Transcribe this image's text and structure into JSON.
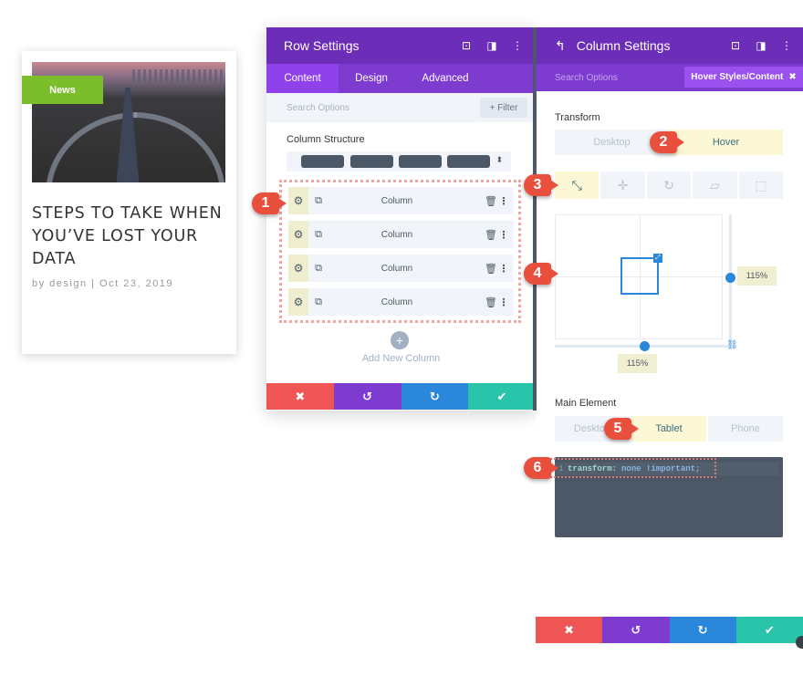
{
  "blog_card": {
    "tag": "News",
    "title": "STEPS TO TAKE WHEN YOU’VE LOST YOUR DATA",
    "meta": "by design | Oct 23, 2019",
    "tag_color": "#7cbd2c"
  },
  "row_settings": {
    "title": "Row Settings",
    "header_icons": [
      "focus-icon",
      "sidebar-toggle-icon",
      "more-vertical-icon"
    ],
    "tabs": [
      {
        "label": "Content",
        "active": true
      },
      {
        "label": "Design",
        "active": false
      },
      {
        "label": "Advanced",
        "active": false
      }
    ],
    "search_placeholder": "Search Options",
    "filter_label": "+ Filter",
    "column_structure_label": "Column Structure",
    "column_structure_blocks": 4,
    "columns": [
      {
        "label": "Column"
      },
      {
        "label": "Column"
      },
      {
        "label": "Column"
      },
      {
        "label": "Column"
      }
    ],
    "add_column_label": "Add New Column",
    "add_column_icon": "+"
  },
  "column_settings": {
    "title": "Column Settings",
    "back_icon": "↰",
    "search_placeholder": "Search Options",
    "hover_pill_label": "Hover Styles/Content",
    "hover_pill_close": "✖",
    "transform": {
      "label": "Transform",
      "modes": [
        {
          "label": "Desktop",
          "active": false
        },
        {
          "label": "Hover",
          "active": true
        }
      ],
      "tools": [
        {
          "name": "scale",
          "glyph": "⤡",
          "active": true
        },
        {
          "name": "translate",
          "glyph": "✛",
          "active": false
        },
        {
          "name": "rotate",
          "glyph": "↻",
          "active": false
        },
        {
          "name": "skew",
          "glyph": "▱",
          "active": false
        },
        {
          "name": "origin",
          "glyph": "⬚",
          "active": false
        }
      ],
      "scale_y": "115%",
      "scale_x": "115%"
    },
    "main_element": {
      "label": "Main Element",
      "devices": [
        {
          "label": "Desktop",
          "active": false
        },
        {
          "label": "Tablet",
          "active": true
        },
        {
          "label": "Phone",
          "active": false
        }
      ],
      "code_line_number": "1",
      "code_property": "transform:",
      "code_value": "none !important;"
    }
  },
  "action_bar": {
    "cancel": "✖",
    "undo": "↺",
    "redo": "↻",
    "save": "✔"
  },
  "callouts": [
    "1",
    "2",
    "3",
    "4",
    "5",
    "6"
  ],
  "colors": {
    "purple_header": "#6c2eb9",
    "purple_tabs": "#7e3bd0",
    "cancel_red": "#ef5555",
    "redo_blue": "#2b87da",
    "save_green": "#29c4a9",
    "callout_red": "#e84f3d",
    "active_yellow": "#fcf7d5"
  }
}
